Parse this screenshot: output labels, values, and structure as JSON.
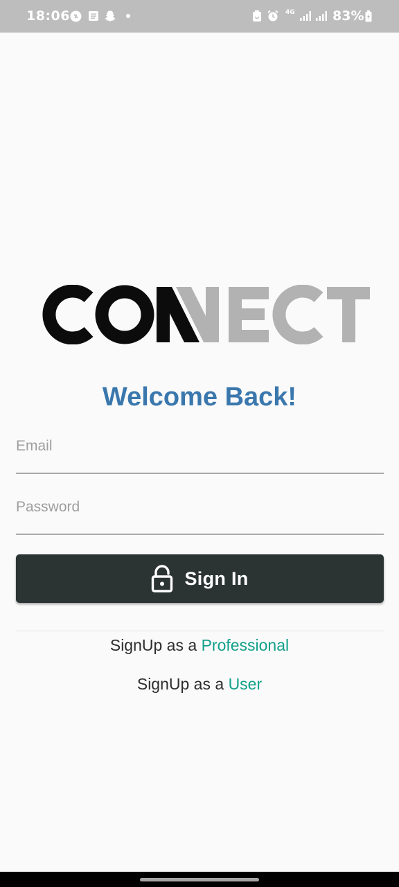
{
  "status_bar": {
    "time": "18:06",
    "network": "4G",
    "battery": "83%",
    "left_icons": [
      "shazam-icon",
      "notes-icon",
      "snapchat-icon",
      "dot-icon"
    ],
    "right_icons": [
      "battery-saver-icon",
      "alarm-icon",
      "signal-icon",
      "signal-icon",
      "battery-charging-icon"
    ]
  },
  "logo": {
    "text_dark": "CON",
    "text_light": "NECT",
    "color_dark": "#0c0c0c",
    "color_light": "#b2b2b2"
  },
  "login": {
    "heading": "Welcome Back!",
    "email_placeholder": "Email",
    "password_placeholder": "Password",
    "signin_label": "Sign In",
    "signin_icon": "lock-open-icon"
  },
  "signup": {
    "professional_prefix": "SignUp as a ",
    "professional_link": "Professional",
    "user_prefix": "SignUp as a ",
    "user_link": "User"
  },
  "colors": {
    "accent": "#3a77ad",
    "link": "#11a08a",
    "button": "#2c3333"
  }
}
